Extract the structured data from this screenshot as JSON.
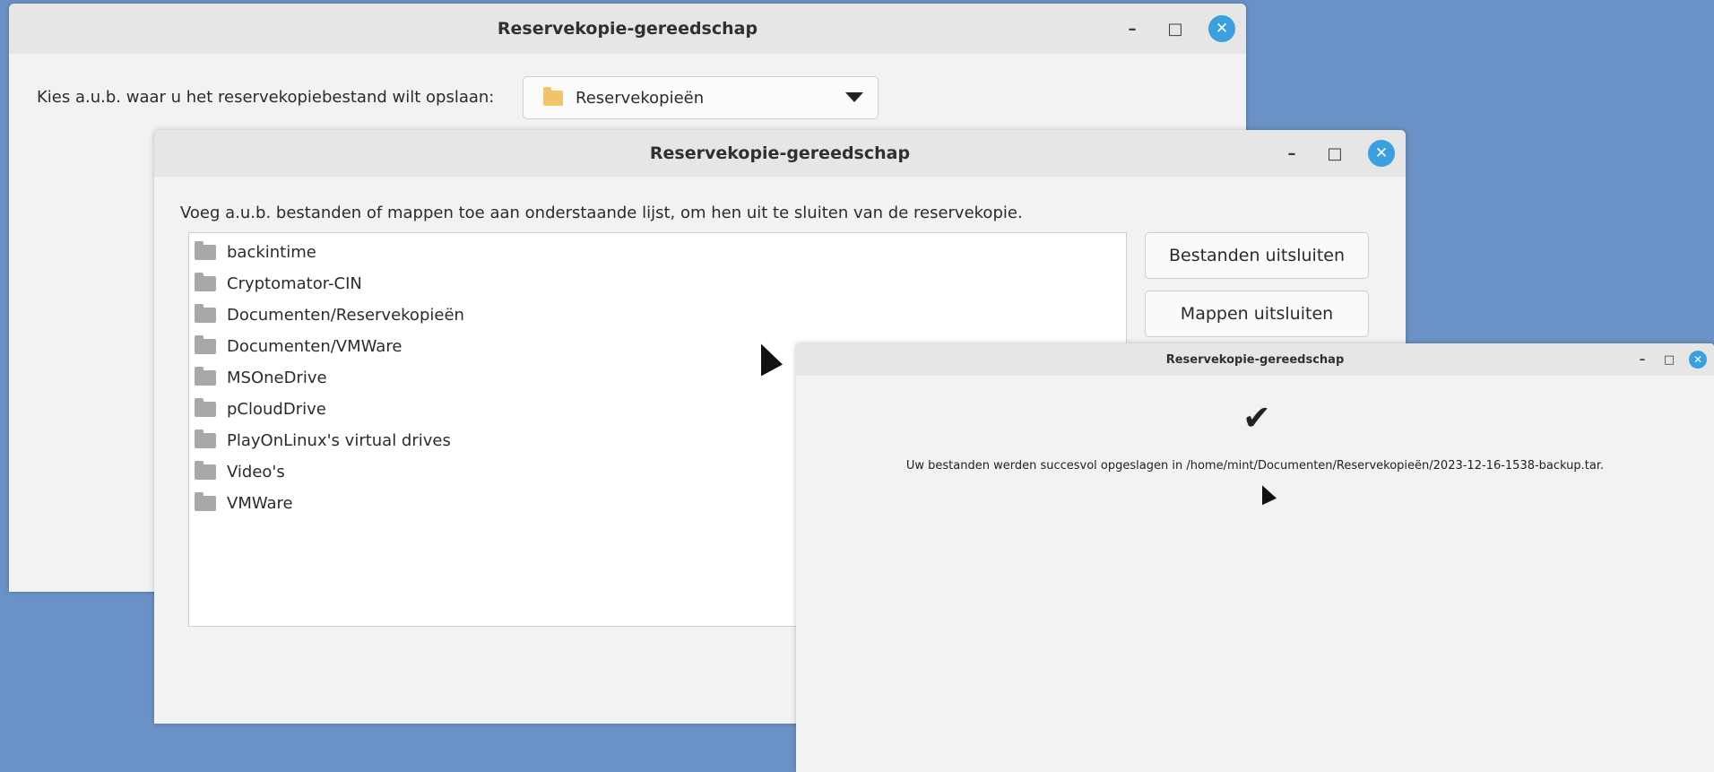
{
  "window1": {
    "title": "Reservekopie-gereedschap",
    "controls": {
      "minimize": "–",
      "maximize": "□",
      "close": "✕"
    },
    "prompt": "Kies a.u.b. waar u het reservekopiebestand wilt opslaan:",
    "destination": {
      "selected": "Reservekopieën",
      "icon": "folder-icon"
    }
  },
  "window2": {
    "title": "Reservekopie-gereedschap",
    "controls": {
      "minimize": "–",
      "maximize": "□",
      "close": "✕"
    },
    "instruction": "Voeg a.u.b. bestanden of mappen toe aan onderstaande lijst, om hen uit te sluiten van de reservekopie.",
    "excluded_items": [
      "backintime",
      "Cryptomator-CIN",
      "Documenten/Reservekopieën",
      "Documenten/VMWare",
      "MSOneDrive",
      "pCloudDrive",
      "PlayOnLinux's virtual drives",
      "Video's",
      "VMWare"
    ],
    "buttons": {
      "exclude_files": "Bestanden uitsluiten",
      "exclude_folders": "Mappen uitsluiten"
    }
  },
  "window3": {
    "title": "Reservekopie-gereedschap",
    "controls": {
      "minimize": "–",
      "maximize": "□",
      "close": "✕"
    },
    "status_icon": "checkmark-icon",
    "checkmark": "✔",
    "message": "Uw bestanden werden succesvol opgeslagen in /home/mint/Documenten/Reservekopieën/2023-12-16-1538-backup.tar."
  },
  "colors": {
    "desktop": "#6b92c6",
    "window_bg": "#f2f2f2",
    "titlebar_bg": "#e6e6e6",
    "close_button": "#3aa0e0",
    "folder_selected": "#f2c46a",
    "folder_list": "#a8a8a8"
  }
}
